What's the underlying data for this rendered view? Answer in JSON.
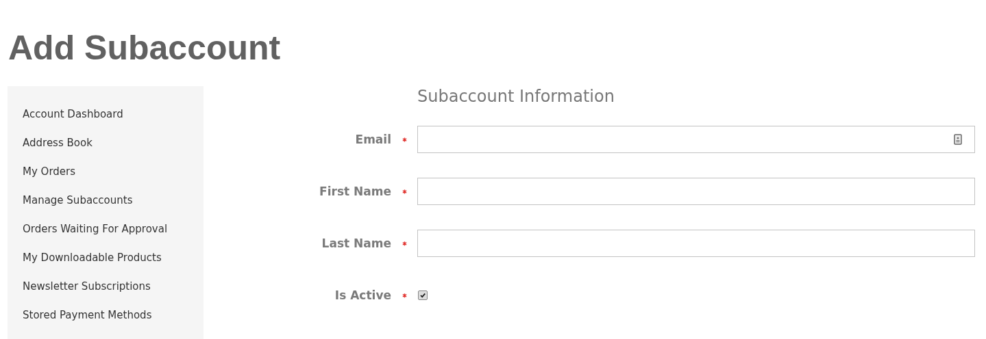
{
  "page_title": "Add Subaccount",
  "sidebar": {
    "items": [
      {
        "label": "Account Dashboard"
      },
      {
        "label": "Address Book"
      },
      {
        "label": "My Orders"
      },
      {
        "label": "Manage Subaccounts"
      },
      {
        "label": "Orders Waiting For Approval"
      },
      {
        "label": "My Downloadable Products"
      },
      {
        "label": "Newsletter Subscriptions"
      },
      {
        "label": "Stored Payment Methods"
      }
    ]
  },
  "form": {
    "legend": "Subaccount Information",
    "fields": [
      {
        "kind": "email",
        "label": "Email",
        "required": true
      },
      {
        "kind": "text",
        "label": "First Name",
        "required": true
      },
      {
        "kind": "text",
        "label": "Last Name",
        "required": true
      },
      {
        "kind": "checkbox",
        "label": "Is Active",
        "required": true,
        "checked": true
      }
    ]
  }
}
